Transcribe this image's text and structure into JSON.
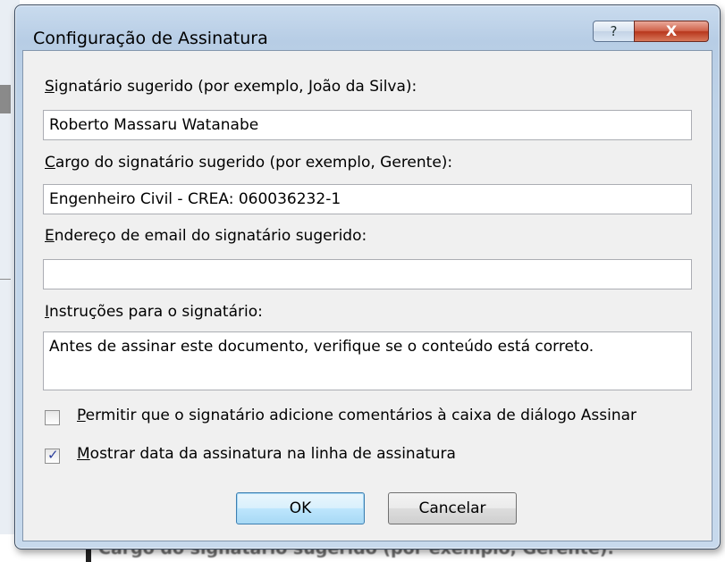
{
  "background": {
    "bottom_text": "Cargo do signatário sugerido (por exemplo, Gerente):"
  },
  "dialog": {
    "title": "Configuração de Assinatura",
    "help_icon": "?",
    "close_icon": "X",
    "signer_label_accel": "S",
    "signer_label_rest": "ignatário sugerido (por exemplo, João da Silva):",
    "signer_value": "Roberto Massaru Watanabe",
    "title_label_accel": "C",
    "title_label_rest": "argo do signatário sugerido (por exemplo, Gerente):",
    "title_value": "Engenheiro Civil - CREA: 060036232-1",
    "email_label_accel": "E",
    "email_label_rest": "ndereço de email do signatário sugerido:",
    "email_value": "",
    "instructions_label_accel": "I",
    "instructions_label_rest": "nstruções para o signatário:",
    "instructions_value": "Antes de assinar este documento, verifique se o conteúdo está correto.",
    "allow_comments_accel": "P",
    "allow_comments_rest": "ermitir que o signatário adicione comentários à caixa de diálogo Assinar",
    "allow_comments_checked": false,
    "show_date_accel": "M",
    "show_date_rest": "ostrar data da assinatura na linha de assinatura",
    "show_date_checked": true,
    "ok_label": "OK",
    "cancel_label": "Cancelar"
  }
}
